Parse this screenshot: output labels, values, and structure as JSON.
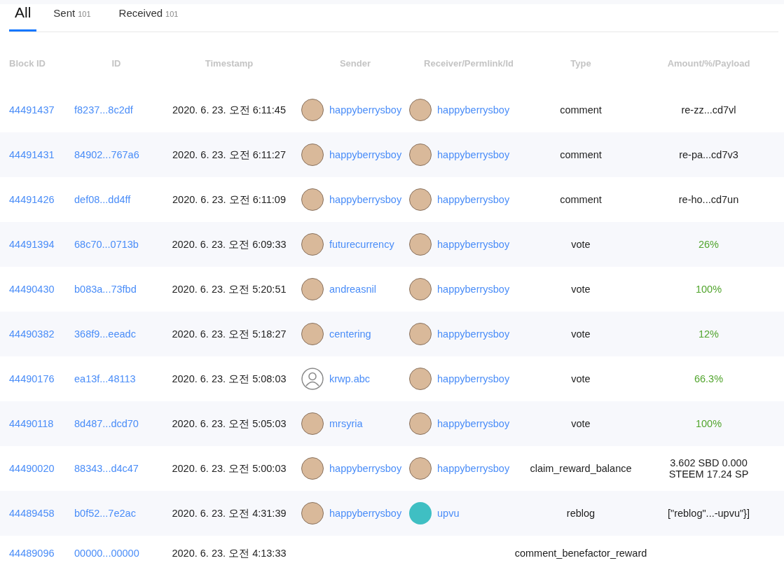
{
  "tabs": [
    {
      "label": "All",
      "selected": true
    },
    {
      "label": "Sent",
      "count": "101",
      "selected": false
    },
    {
      "label": "Received",
      "count": "101",
      "selected": false
    }
  ],
  "table": {
    "columns": [
      "Block ID",
      "ID",
      "Timestamp",
      "Sender",
      "Receiver/Permlink/Id",
      "Type",
      "Amount/%/Payload"
    ],
    "rows": [
      {
        "block_id": "44491437",
        "id": "f8237...8c2df",
        "timestamp": "2020. 6. 23. 오전 6:11:45",
        "sender": {
          "name": "happyberrysboy",
          "kind": "photo"
        },
        "receiver": {
          "name": "happyberrysboy",
          "kind": "photo"
        },
        "type": "comment",
        "amount": {
          "kind": "text",
          "text": "re-zz...cd7vl"
        }
      },
      {
        "block_id": "44491431",
        "id": "84902...767a6",
        "timestamp": "2020. 6. 23. 오전 6:11:27",
        "sender": {
          "name": "happyberrysboy",
          "kind": "photo"
        },
        "receiver": {
          "name": "happyberrysboy",
          "kind": "photo"
        },
        "type": "comment",
        "amount": {
          "kind": "text",
          "text": "re-pa...cd7v3"
        }
      },
      {
        "block_id": "44491426",
        "id": "def08...dd4ff",
        "timestamp": "2020. 6. 23. 오전 6:11:09",
        "sender": {
          "name": "happyberrysboy",
          "kind": "photo"
        },
        "receiver": {
          "name": "happyberrysboy",
          "kind": "photo"
        },
        "type": "comment",
        "amount": {
          "kind": "text",
          "text": "re-ho...cd7un"
        }
      },
      {
        "block_id": "44491394",
        "id": "68c70...0713b",
        "timestamp": "2020. 6. 23. 오전 6:09:33",
        "sender": {
          "name": "futurecurrency",
          "kind": "photo"
        },
        "receiver": {
          "name": "happyberrysboy",
          "kind": "photo"
        },
        "type": "vote",
        "amount": {
          "kind": "percent",
          "text": "26%"
        }
      },
      {
        "block_id": "44490430",
        "id": "b083a...73fbd",
        "timestamp": "2020. 6. 23. 오전 5:20:51",
        "sender": {
          "name": "andreasnil",
          "kind": "photo"
        },
        "receiver": {
          "name": "happyberrysboy",
          "kind": "photo"
        },
        "type": "vote",
        "amount": {
          "kind": "percent",
          "text": "100%"
        }
      },
      {
        "block_id": "44490382",
        "id": "368f9...eeadc",
        "timestamp": "2020. 6. 23. 오전 5:18:27",
        "sender": {
          "name": "centering",
          "kind": "photo"
        },
        "receiver": {
          "name": "happyberrysboy",
          "kind": "photo"
        },
        "type": "vote",
        "amount": {
          "kind": "percent",
          "text": "12%"
        }
      },
      {
        "block_id": "44490176",
        "id": "ea13f...48113",
        "timestamp": "2020. 6. 23. 오전 5:08:03",
        "sender": {
          "name": "krwp.abc",
          "kind": "silhouette"
        },
        "receiver": {
          "name": "happyberrysboy",
          "kind": "photo"
        },
        "type": "vote",
        "amount": {
          "kind": "percent",
          "text": "66.3%"
        }
      },
      {
        "block_id": "44490118",
        "id": "8d487...dcd70",
        "timestamp": "2020. 6. 23. 오전 5:05:03",
        "sender": {
          "name": "mrsyria",
          "kind": "photo"
        },
        "receiver": {
          "name": "happyberrysboy",
          "kind": "photo"
        },
        "type": "vote",
        "amount": {
          "kind": "percent",
          "text": "100%"
        }
      },
      {
        "block_id": "44490020",
        "id": "88343...d4c47",
        "timestamp": "2020. 6. 23. 오전 5:00:03",
        "sender": {
          "name": "happyberrysboy",
          "kind": "photo"
        },
        "receiver": {
          "name": "happyberrysboy",
          "kind": "photo"
        },
        "type": "claim_reward_balance",
        "amount": {
          "kind": "text",
          "text": "3.602 SBD 0.000 STEEM 17.24 SP"
        }
      },
      {
        "block_id": "44489458",
        "id": "b0f52...7e2ac",
        "timestamp": "2020. 6. 23. 오전 4:31:39",
        "sender": {
          "name": "happyberrysboy",
          "kind": "photo"
        },
        "receiver": {
          "name": "upvu",
          "kind": "logo"
        },
        "type": "reblog",
        "amount": {
          "kind": "text",
          "text": "[\"reblog\"...-upvu\"}]"
        }
      },
      {
        "block_id": "44489096",
        "id": "00000...00000",
        "timestamp": "2020. 6. 23. 오전 4:13:33",
        "type": "comment_benefactor_reward"
      }
    ]
  }
}
